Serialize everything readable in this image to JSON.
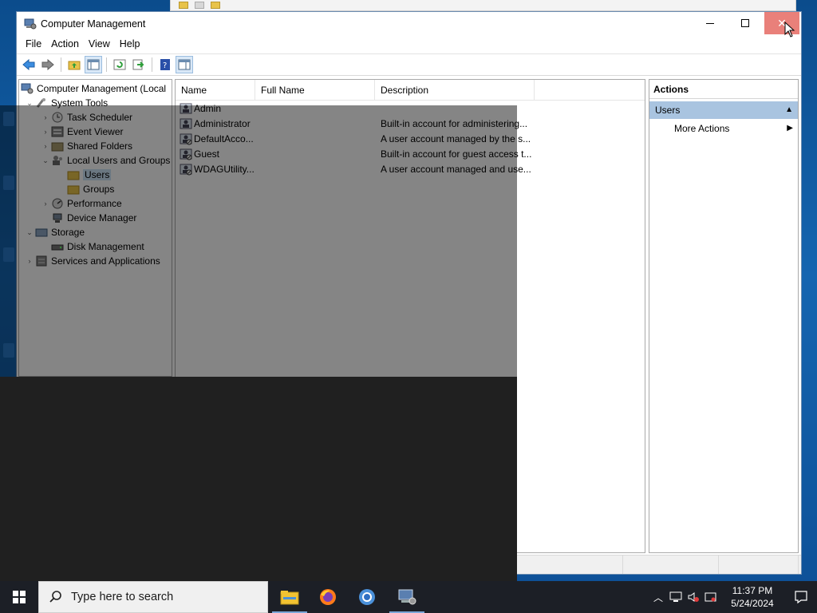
{
  "window": {
    "title": "Computer Management",
    "controls": {
      "minimize": "",
      "maximize": "",
      "close": "✕"
    }
  },
  "menu": [
    "File",
    "Action",
    "View",
    "Help"
  ],
  "tree": [
    {
      "label": "Computer Management (Local",
      "icon": "computer-management-icon",
      "chevron": ""
    },
    {
      "label": "System Tools",
      "icon": "system-tools-icon",
      "chevron": "v"
    },
    {
      "label": "Task Scheduler",
      "icon": "clock-icon",
      "chevron": ">"
    },
    {
      "label": "Event Viewer",
      "icon": "event-viewer-icon",
      "chevron": ">"
    },
    {
      "label": "Shared Folders",
      "icon": "shared-folder-icon",
      "chevron": ">"
    },
    {
      "label": "Local Users and Groups",
      "icon": "users-groups-icon",
      "chevron": "v"
    },
    {
      "label": "Users",
      "icon": "folder-icon",
      "chevron": ""
    },
    {
      "label": "Groups",
      "icon": "folder-icon",
      "chevron": ""
    },
    {
      "label": "Performance",
      "icon": "performance-icon",
      "chevron": ">"
    },
    {
      "label": "Device Manager",
      "icon": "device-manager-icon",
      "chevron": ""
    },
    {
      "label": "Storage",
      "icon": "storage-icon",
      "chevron": "v"
    },
    {
      "label": "Disk Management",
      "icon": "disk-icon",
      "chevron": ""
    },
    {
      "label": "Services and Applications",
      "icon": "services-icon",
      "chevron": ">"
    }
  ],
  "list": {
    "columns": [
      "Name",
      "Full Name",
      "Description"
    ],
    "rows": [
      {
        "name": "Admin",
        "full_name": "",
        "description": ""
      },
      {
        "name": "Administrator",
        "full_name": "",
        "description": "Built-in account for administering..."
      },
      {
        "name": "DefaultAcco...",
        "full_name": "",
        "description": "A user account managed by the s..."
      },
      {
        "name": "Guest",
        "full_name": "",
        "description": "Built-in account for guest access t..."
      },
      {
        "name": "WDAGUtility...",
        "full_name": "",
        "description": "A user account managed and use..."
      }
    ]
  },
  "actions": {
    "header": "Actions",
    "section": "Users",
    "items": [
      "More Actions"
    ]
  },
  "taskbar": {
    "search_placeholder": "Type here to search",
    "apps": [
      "file-explorer-icon",
      "firefox-icon",
      "chrome-icon",
      "computer-management-icon"
    ],
    "time": "11:37 PM",
    "date": "5/24/2024"
  },
  "colors": {
    "accent": "#0078d7",
    "close_hover": "#e9807a",
    "selection": "#cce4f7",
    "actions_section": "#a9c4e0",
    "taskbar": "#1c1f26"
  }
}
